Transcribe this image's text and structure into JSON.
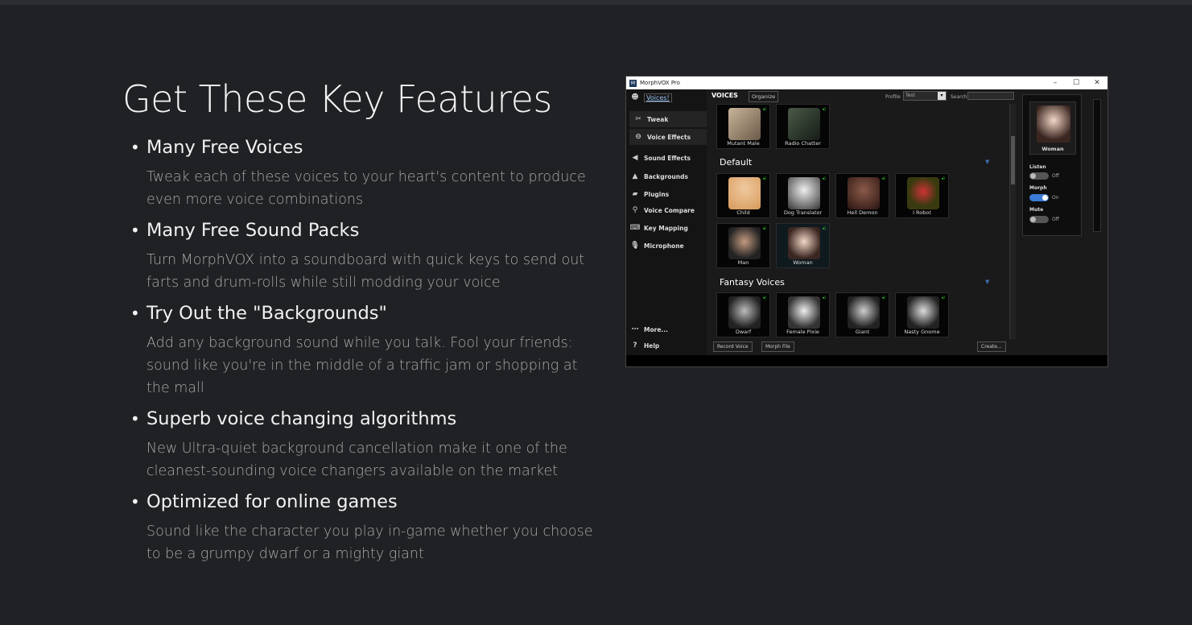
{
  "heading": "Get These Key Features",
  "features": [
    {
      "title": "Many Free Voices",
      "desc": "Tweak each of these voices to your heart's content to produce even more voice combinations"
    },
    {
      "title": "Many Free Sound Packs",
      "desc": "Turn MorphVOX into a soundboard with quick keys to send out farts and drum-rolls while still modding your voice"
    },
    {
      "title": "Try Out the \"Backgrounds\"",
      "desc": "Add any background sound while you talk. Fool your friends: sound like you're in the middle of a traffic jam or shopping at the mall"
    },
    {
      "title": "Superb voice changing algorithms",
      "desc": "New Ultra-quiet background cancellation make it one of the cleanest-sounding voice changers available on the market"
    },
    {
      "title": "Optimized for online games",
      "desc": "Sound like the character you play in-game whether you choose to be a grumpy dwarf or a mighty giant"
    }
  ],
  "app": {
    "title": "MorphVOX Pro",
    "app_icon": "M",
    "controls": {
      "minimize": "–",
      "maximize": "☐",
      "close": "✕"
    },
    "sidebar": {
      "voices": "Voices!",
      "tweak": "Tweak",
      "voice_effects": "Voice Effects",
      "sound_effects": "Sound Effects",
      "backgrounds": "Backgrounds",
      "plugins": "Plugins",
      "voice_compare": "Voice Compare",
      "key_mapping": "Key Mapping",
      "microphone": "Microphone",
      "more": "More...",
      "help": "Help"
    },
    "header": {
      "voices_label": "VOICES",
      "organize": "Organize",
      "profile_label": "Profile",
      "profile_value": "Test",
      "search_label": "Search"
    },
    "top_voices": [
      "Mutant Male",
      "Radio Chatter"
    ],
    "categories": {
      "default": "Default",
      "fantasy": "Fantasy Voices"
    },
    "default_voices": [
      "Child",
      "Dog Translator",
      "Hell Demon",
      "I Robot",
      "Man",
      "Woman"
    ],
    "fantasy_voices": [
      "Dwarf",
      "Female Pixie",
      "Giant",
      "Nasty Gnome"
    ],
    "bottom": {
      "record": "Record Voice",
      "morph_file": "Morph File",
      "create": "Create..."
    },
    "right_panel": {
      "current_voice": "Woman",
      "listen_label": "Listen",
      "listen_state": "Off",
      "morph_label": "Morph",
      "morph_state": "On",
      "mute_label": "Mute",
      "mute_state": "Off"
    }
  }
}
